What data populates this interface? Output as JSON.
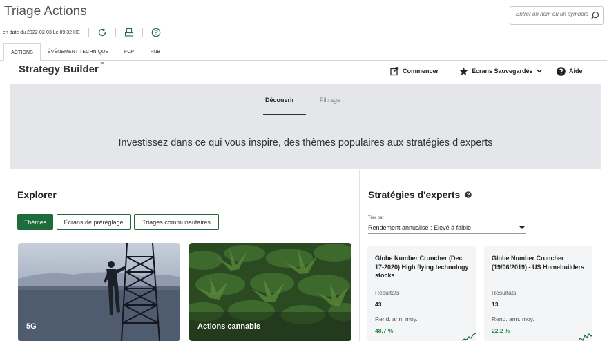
{
  "header": {
    "title": "Triage Actions",
    "search_placeholder": "Entrer un nom ou un symbole",
    "date_text": "en date du 2022-02-03 Le 09:32 HE"
  },
  "tabs": [
    {
      "label": "ACTIONS",
      "active": true
    },
    {
      "label": "ÉVÉNEMENT TECHNIQUE",
      "active": false
    },
    {
      "label": "FCP",
      "active": false
    },
    {
      "label": "FNB",
      "active": false
    }
  ],
  "strategy_builder": {
    "title": "Strategy Builder",
    "trademark": "™",
    "actions": {
      "commencer": "Commencer",
      "ecrans": "Ecrans Sauvegardés",
      "aide": "Aide"
    }
  },
  "hero": {
    "tab_discover": "Découvrir",
    "tab_filter": "Filtrage",
    "text": "Investissez dans ce qui vous inspire, des thèmes populaires aux stratégies d'experts"
  },
  "explorer": {
    "title": "Explorer",
    "pills": [
      "Thèmes",
      "Écrans de préréglage",
      "Triages communautaires"
    ],
    "cards": [
      {
        "label": "5G"
      },
      {
        "label": "Actions cannabis"
      }
    ]
  },
  "experts": {
    "title": "Stratégies d'experts",
    "sort_label": "Trier par",
    "sort_value": "Rendement annualisé : Elevé à faible",
    "results_label": "Résultats",
    "return_label": "Rend. ann. moy.",
    "cards": [
      {
        "name": "Globe Number Cruncher (Dec 17-2020) High flying technology stocks",
        "results": "43",
        "return": "48,7 %"
      },
      {
        "name": "Globe Number Cruncher (19/06/2019) - US Homebuilders",
        "results": "13",
        "return": "22,2 %"
      }
    ]
  },
  "colors": {
    "accent_green": "#1e6b3c",
    "positive_green": "#1e8a3c",
    "hero_bg": "#e4e6ea"
  }
}
